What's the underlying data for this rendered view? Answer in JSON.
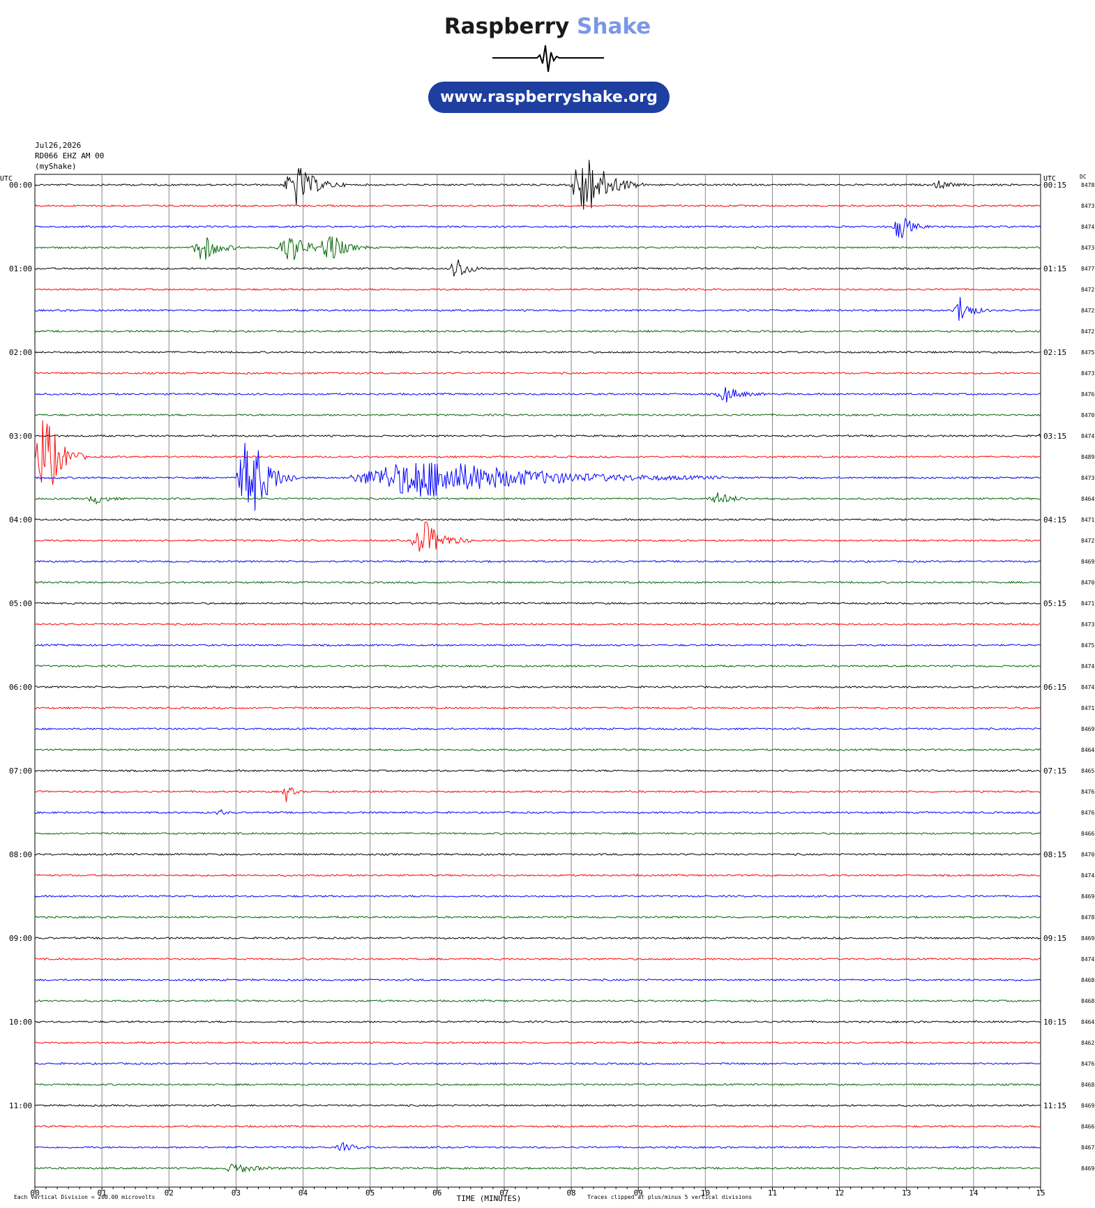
{
  "branding": {
    "brand_part1": "Raspberry",
    "brand_part2": "Shake",
    "url": "www.raspberryshake.org"
  },
  "header": {
    "date": "Jul26,2026",
    "station": "RD066 EHZ AM 00",
    "network": "(myShake)"
  },
  "colors": {
    "trace_cycle": [
      "#000000",
      "#ff0000",
      "#0000ff",
      "#006400"
    ],
    "grid": "#888888",
    "brand_accent": "#7b97e6",
    "pill": "#1e3fa0"
  },
  "chart_data": {
    "type": "line",
    "title": "",
    "xlabel": "TIME (MINUTES)",
    "left_axis_label": "UTC",
    "right_axis_label": "UTC",
    "dc_label": "DC",
    "xlim": [
      0,
      15
    ],
    "x_ticks": [
      "00",
      "01",
      "02",
      "03",
      "04",
      "05",
      "06",
      "07",
      "08",
      "09",
      "10",
      "11",
      "12",
      "13",
      "14",
      "15"
    ],
    "row_interval_minutes": 15,
    "left_hour_labels": [
      "00:00",
      "01:00",
      "02:00",
      "03:00",
      "04:00",
      "05:00",
      "06:00",
      "07:00",
      "08:00",
      "09:00",
      "10:00",
      "11:00"
    ],
    "right_hour_labels": [
      "00:15",
      "01:15",
      "02:15",
      "03:15",
      "04:15",
      "05:15",
      "06:15",
      "07:15",
      "08:15",
      "09:15",
      "10:15",
      "11:15"
    ],
    "dc_values": [
      "8478",
      "8473",
      "8474",
      "8473",
      "8477",
      "8472",
      "8472",
      "8472",
      "8475",
      "8473",
      "8476",
      "8470",
      "8474",
      "8489",
      "8473",
      "8464",
      "8471",
      "8472",
      "8469",
      "8470",
      "8471",
      "8473",
      "8475",
      "8474",
      "8474",
      "8471",
      "8469",
      "8464",
      "8465",
      "8476",
      "8476",
      "8466",
      "8470",
      "8474",
      "8469",
      "8478",
      "8469",
      "8474",
      "8468",
      "8468",
      "8464",
      "8462",
      "8476",
      "8468",
      "8469",
      "8466",
      "8467",
      "8469"
    ],
    "events": [
      {
        "row": 0,
        "minute": 3.9,
        "amplitude": 2.2,
        "duration": 0.5
      },
      {
        "row": 0,
        "minute": 8.2,
        "amplitude": 3.5,
        "duration": 0.6
      },
      {
        "row": 0,
        "minute": 13.5,
        "amplitude": 0.4,
        "duration": 0.3
      },
      {
        "row": 2,
        "minute": 12.9,
        "amplitude": 1.4,
        "duration": 0.3
      },
      {
        "row": 3,
        "minute": 2.5,
        "amplitude": 1.5,
        "duration": 0.4
      },
      {
        "row": 3,
        "minute": 3.8,
        "amplitude": 1.5,
        "duration": 0.5
      },
      {
        "row": 3,
        "minute": 4.4,
        "amplitude": 1.5,
        "duration": 0.4
      },
      {
        "row": 4,
        "minute": 6.3,
        "amplitude": 1.2,
        "duration": 0.3
      },
      {
        "row": 6,
        "minute": 13.8,
        "amplitude": 1.4,
        "duration": 0.3
      },
      {
        "row": 10,
        "minute": 10.3,
        "amplitude": 0.8,
        "duration": 0.4
      },
      {
        "row": 12,
        "minute": 15.0,
        "amplitude": 1.2,
        "duration": 0.1
      },
      {
        "row": 13,
        "minute": 0.15,
        "amplitude": 5.0,
        "duration": 0.4
      },
      {
        "row": 14,
        "minute": 3.2,
        "amplitude": 5.0,
        "duration": 0.5
      },
      {
        "row": 14,
        "minute": 5.8,
        "amplitude": 2.0,
        "duration": 3.0
      },
      {
        "row": 15,
        "minute": 0.9,
        "amplitude": 0.5,
        "duration": 0.3
      },
      {
        "row": 15,
        "minute": 10.2,
        "amplitude": 0.6,
        "duration": 0.4
      },
      {
        "row": 17,
        "minute": 5.8,
        "amplitude": 2.0,
        "duration": 0.5
      },
      {
        "row": 29,
        "minute": 3.75,
        "amplitude": 1.0,
        "duration": 0.15
      },
      {
        "row": 30,
        "minute": 2.75,
        "amplitude": 0.6,
        "duration": 0.1
      },
      {
        "row": 46,
        "minute": 4.6,
        "amplitude": 0.4,
        "duration": 0.3
      },
      {
        "row": 47,
        "minute": 3.0,
        "amplitude": 0.5,
        "duration": 0.5
      }
    ]
  },
  "footer": {
    "scale_note": "Each Vertical Division =  200.00 microvolts",
    "clip_note": "Traces clipped at plus/minus 5 vertical divisions"
  }
}
